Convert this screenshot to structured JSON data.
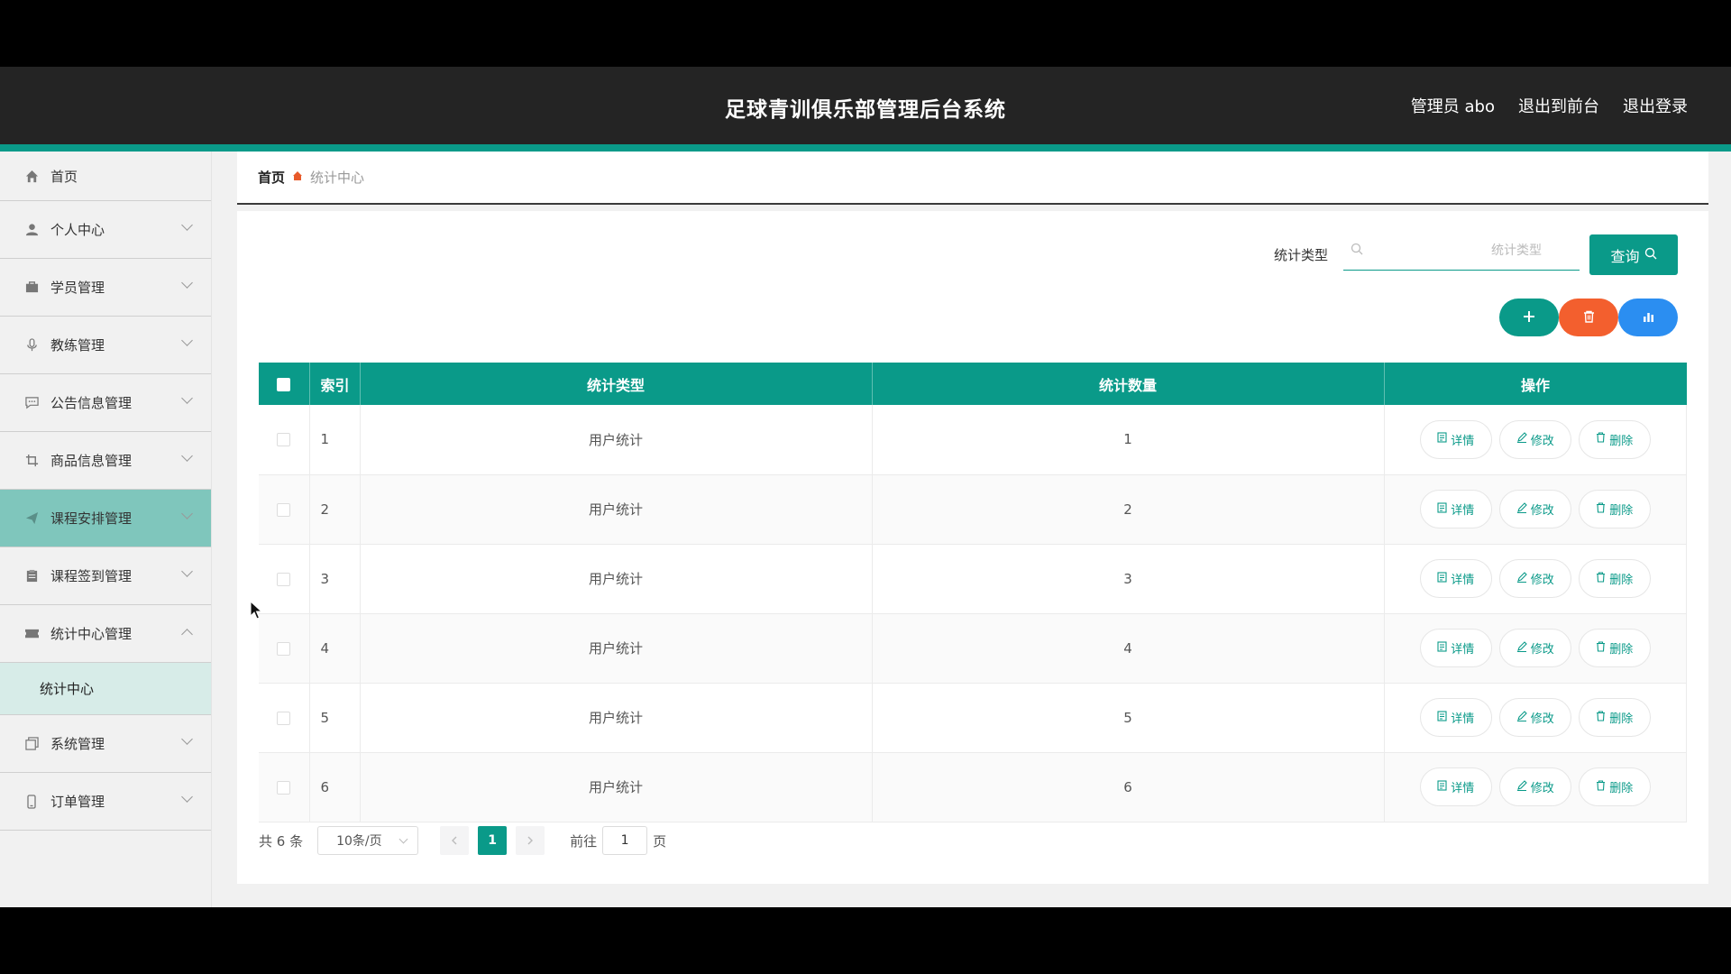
{
  "header": {
    "title": "足球青训俱乐部管理后台系统",
    "user": "管理员 abo",
    "to_front": "退出到前台",
    "logout": "退出登录"
  },
  "sidebar": {
    "items": [
      {
        "label": "首页",
        "icon": "home-icon"
      },
      {
        "label": "个人中心",
        "icon": "user-icon"
      },
      {
        "label": "学员管理",
        "icon": "briefcase-icon"
      },
      {
        "label": "教练管理",
        "icon": "microphone-icon"
      },
      {
        "label": "公告信息管理",
        "icon": "message-icon"
      },
      {
        "label": "商品信息管理",
        "icon": "crop-icon"
      },
      {
        "label": "课程安排管理",
        "icon": "paper-plane-icon"
      },
      {
        "label": "课程签到管理",
        "icon": "clipboard-icon"
      },
      {
        "label": "统计中心管理",
        "icon": "ticket-icon"
      },
      {
        "label": "系统管理",
        "icon": "copy-icon"
      },
      {
        "label": "订单管理",
        "icon": "mobile-icon"
      }
    ],
    "submenu": {
      "label": "统计中心"
    }
  },
  "breadcrumb": {
    "home": "首页",
    "current": "统计中心"
  },
  "search": {
    "label": "统计类型",
    "placeholder": "统计类型",
    "query_label": "查询"
  },
  "table": {
    "headers": {
      "index": "索引",
      "type": "统计类型",
      "count": "统计数量",
      "actions": "操作"
    },
    "rows": [
      {
        "index": "1",
        "type": "用户统计",
        "count": "1"
      },
      {
        "index": "2",
        "type": "用户统计",
        "count": "2"
      },
      {
        "index": "3",
        "type": "用户统计",
        "count": "3"
      },
      {
        "index": "4",
        "type": "用户统计",
        "count": "4"
      },
      {
        "index": "5",
        "type": "用户统计",
        "count": "5"
      },
      {
        "index": "6",
        "type": "用户统计",
        "count": "6"
      }
    ],
    "actions": {
      "detail": "详情",
      "edit": "修改",
      "delete": "删除"
    }
  },
  "pager": {
    "total": "共 6 条",
    "page_size": "10条/页",
    "current_page": "1",
    "goto_label": "前往",
    "goto_value": "1",
    "page_suffix": "页"
  },
  "colors": {
    "accent": "#0a9a89",
    "danger": "#f35f2e",
    "info": "#2b8ef1",
    "header_bg": "#242424"
  }
}
